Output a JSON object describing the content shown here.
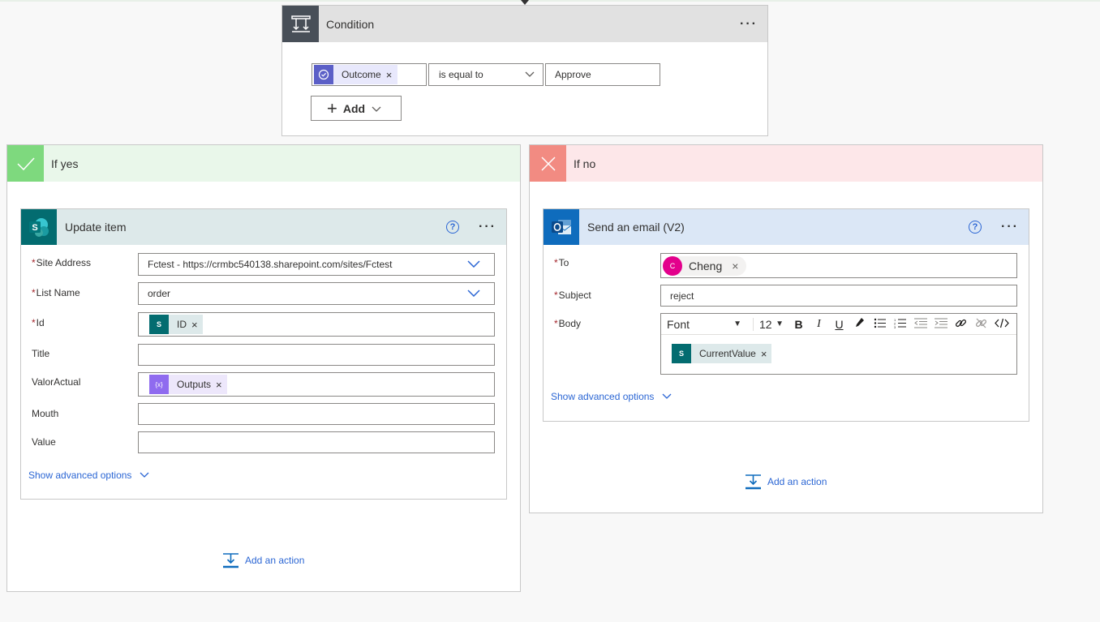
{
  "condition": {
    "title": "Condition",
    "menu_label": "···",
    "left_operand": "Outcome",
    "operator": "is equal to",
    "right_operand": "Approve",
    "add_label": "Add",
    "token_remove": "×"
  },
  "branches": {
    "yes": {
      "title": "If yes",
      "action": {
        "title": "Update item",
        "help": "?",
        "menu_label": "···",
        "fields": {
          "site_address": {
            "label": "Site Address",
            "value": "Fctest - https://crmbc540138.sharepoint.com/sites/Fctest"
          },
          "list_name": {
            "label": "List Name",
            "value": "order"
          },
          "id": {
            "label": "Id",
            "token": "ID",
            "token_icon_text": "S"
          },
          "title": {
            "label": "Title",
            "value": ""
          },
          "valor_actual": {
            "label": "ValorActual",
            "token": "Outputs",
            "token_icon_text": "{x}"
          },
          "mouth": {
            "label": "Mouth",
            "value": ""
          },
          "value": {
            "label": "Value",
            "value": ""
          }
        },
        "required_marker": "*",
        "show_advanced": "Show advanced options"
      },
      "add_action": "Add an action"
    },
    "no": {
      "title": "If no",
      "action": {
        "title": "Send an email (V2)",
        "help": "?",
        "menu_label": "···",
        "fields": {
          "to": {
            "label": "To",
            "person_initial": "C",
            "person_name": "Cheng"
          },
          "subject": {
            "label": "Subject",
            "value": "reject"
          },
          "body": {
            "label": "Body",
            "font": "Font",
            "size": "12",
            "token": "CurrentValue",
            "token_icon_text": "S"
          }
        },
        "required_marker": "*",
        "show_advanced": "Show advanced options"
      },
      "add_action": "Add an action"
    }
  },
  "colors": {
    "link_blue": "#2b66d4",
    "sharepoint_teal": "#036c70",
    "outlook_blue": "#0f6cbd",
    "yes_green": "#7ed97e",
    "no_red": "#f28b82",
    "expression_purple": "#8f6bef",
    "required_red": "#a4262c"
  }
}
